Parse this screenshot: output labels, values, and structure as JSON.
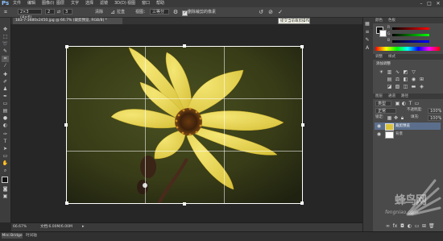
{
  "menubar": {
    "logo": "Ps",
    "items": [
      "文件(F)",
      "编辑(E)",
      "图像(I)",
      "图层(L)",
      "文字(Y)",
      "选择(S)",
      "滤镜(T)",
      "3D(D)",
      "视图(V)",
      "窗口(W)",
      "帮助(H)"
    ],
    "min": "–",
    "max": "□",
    "close": "✕"
  },
  "options": {
    "ratio_value": "2×3 (4×6)",
    "width_value": "2",
    "height_value": "3",
    "clear_label": "清除",
    "straighten_label": "拉直",
    "view_label": "视图：",
    "view_value": "三等分",
    "delete_label": "删除裁剪的像素",
    "delete_checked": true
  },
  "tooltip": "提交当前裁剪操作",
  "document": {
    "tab_title": "183-7-3680x2450.jpg @ 66.7% (裁剪预览, RGB/8) *"
  },
  "status": {
    "zoom": "66.67%",
    "doc_info": "文档:6.00M/6.00M"
  },
  "bottom_tabs": [
    "Mini Bridge",
    "时间轴"
  ],
  "panels": {
    "color_tab": "颜色",
    "swatches_tab": "色板",
    "styles_tab": "样式",
    "channel_labels": [
      "R",
      "G",
      "B"
    ],
    "adjust_tab": "调整",
    "add_adjust": "添加调整",
    "layers_tab": "图层",
    "channels_tab": "通道",
    "paths_tab": "路径",
    "kind_label": "类型",
    "blend_mode": "正常",
    "opacity_label": "不透明度:",
    "opacity_value": "100%",
    "lock_label": "锁定:",
    "fill_label": "填充:",
    "fill_value": "100%",
    "layers": [
      {
        "name": "裁剪预览",
        "selected": true
      },
      {
        "name": "背景",
        "selected": false
      }
    ]
  },
  "watermark": {
    "text_cn": "蜂鸟网",
    "text_en": "fengniao.com"
  },
  "colors": {
    "accent": "#8ec3ff",
    "flower_petal": "#e8d550",
    "flower_center": "#4a2a12",
    "background_green": "#3c4018"
  }
}
